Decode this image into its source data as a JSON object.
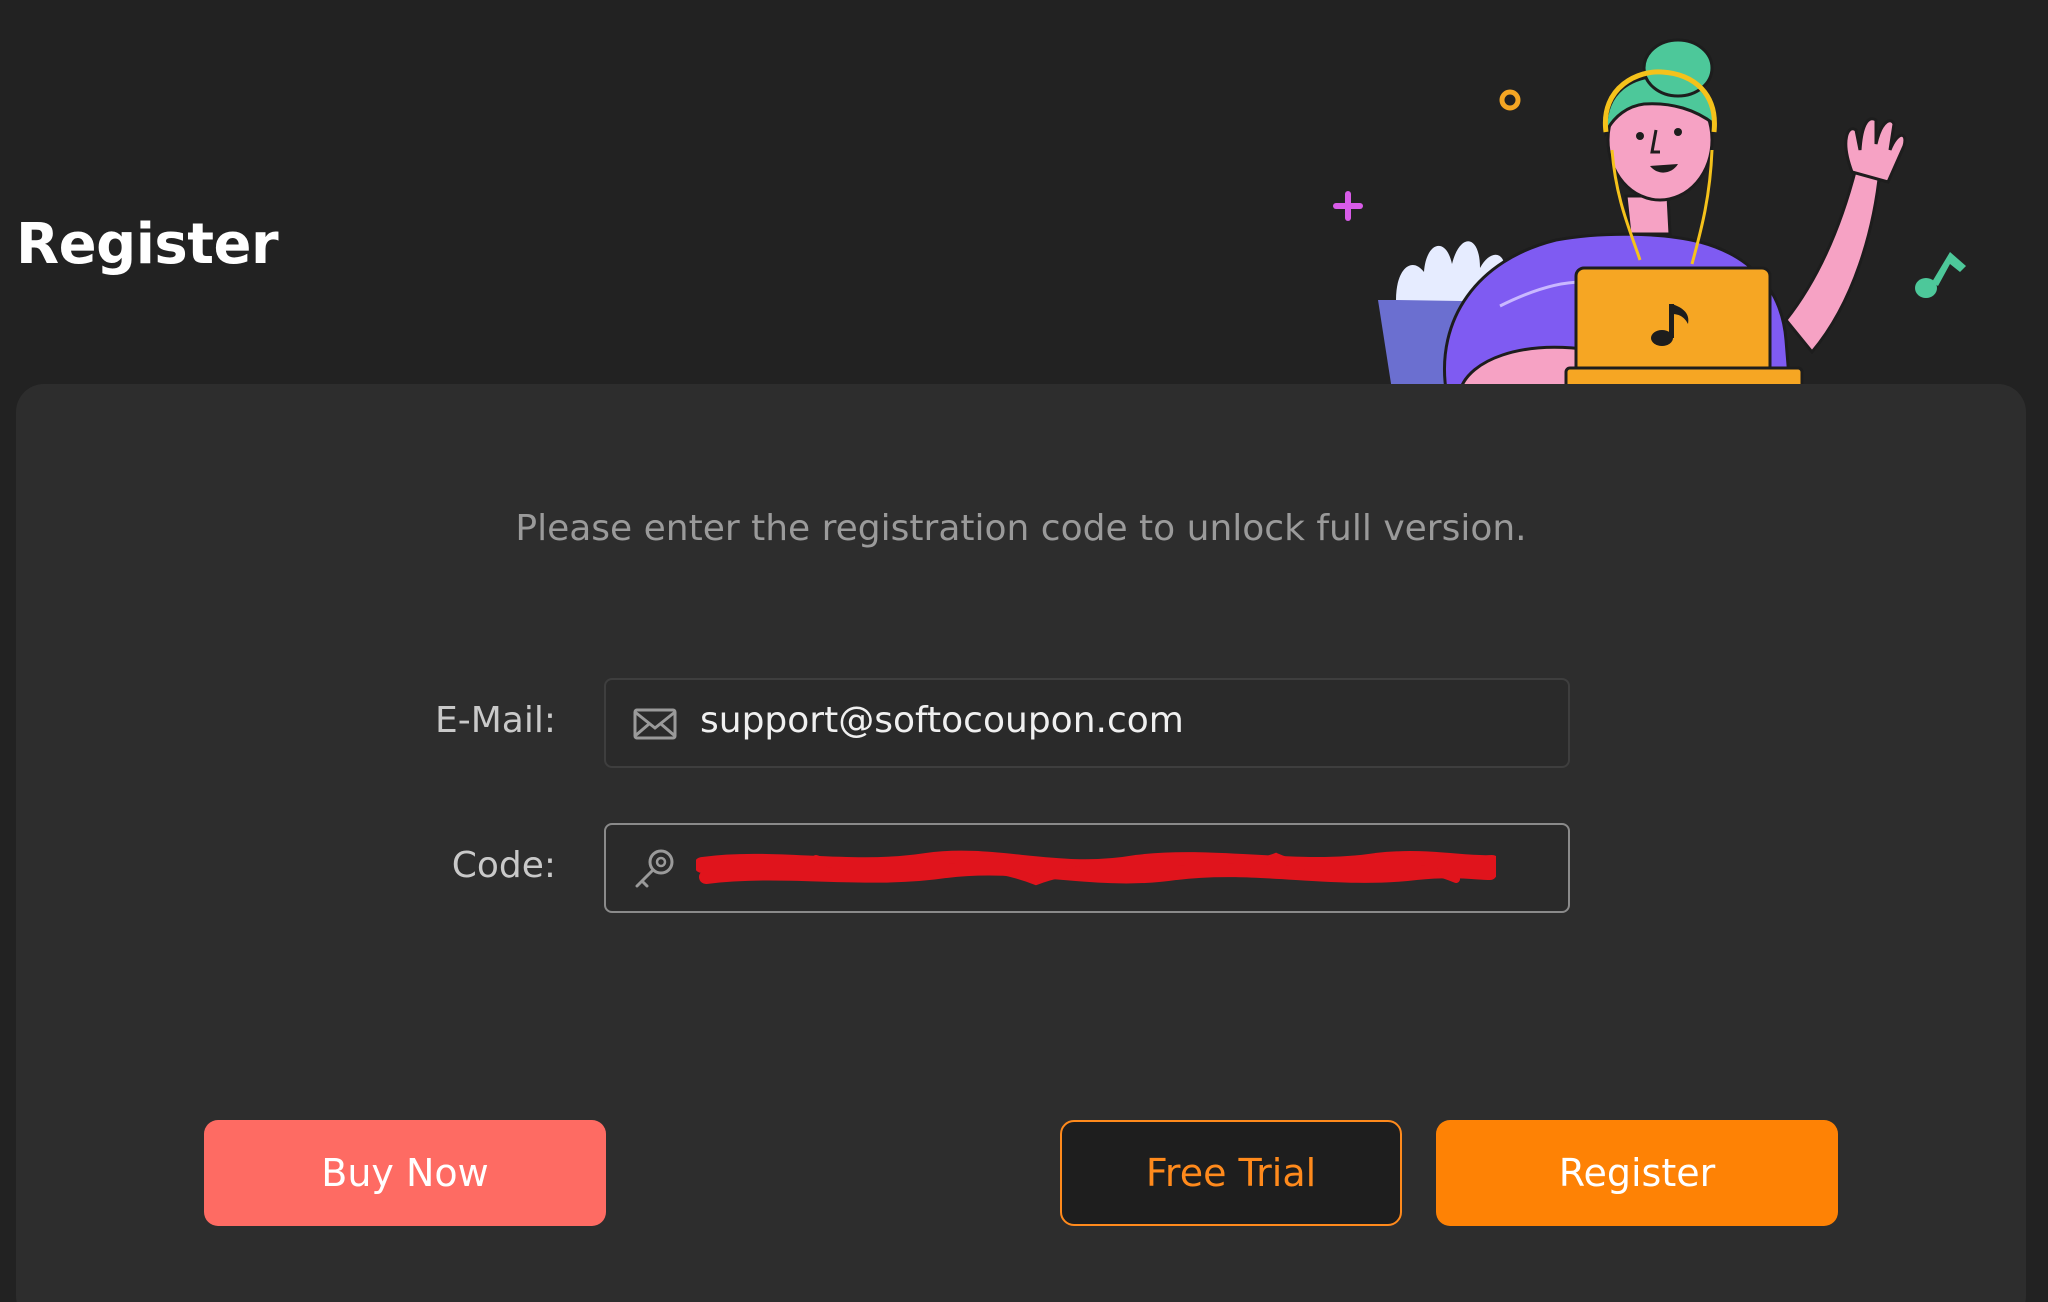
{
  "window": {
    "title": "Register"
  },
  "form": {
    "instruction": "Please enter the registration code to unlock full version.",
    "email": {
      "label": "E-Mail:",
      "value": "support@softocoupon.com",
      "icon": "envelope-icon"
    },
    "code": {
      "label": "Code:",
      "value": "",
      "icon": "key-icon",
      "redacted": true
    }
  },
  "buttons": {
    "buy_now": "Buy Now",
    "free_trial": "Free Trial",
    "register": "Register"
  },
  "colors": {
    "background": "#222222",
    "panel": "#2d2d2d",
    "buy_now": "#fe6b63",
    "register": "#fe8205",
    "free_trial_accent": "#ff8a1c",
    "redaction": "#e0141c"
  }
}
